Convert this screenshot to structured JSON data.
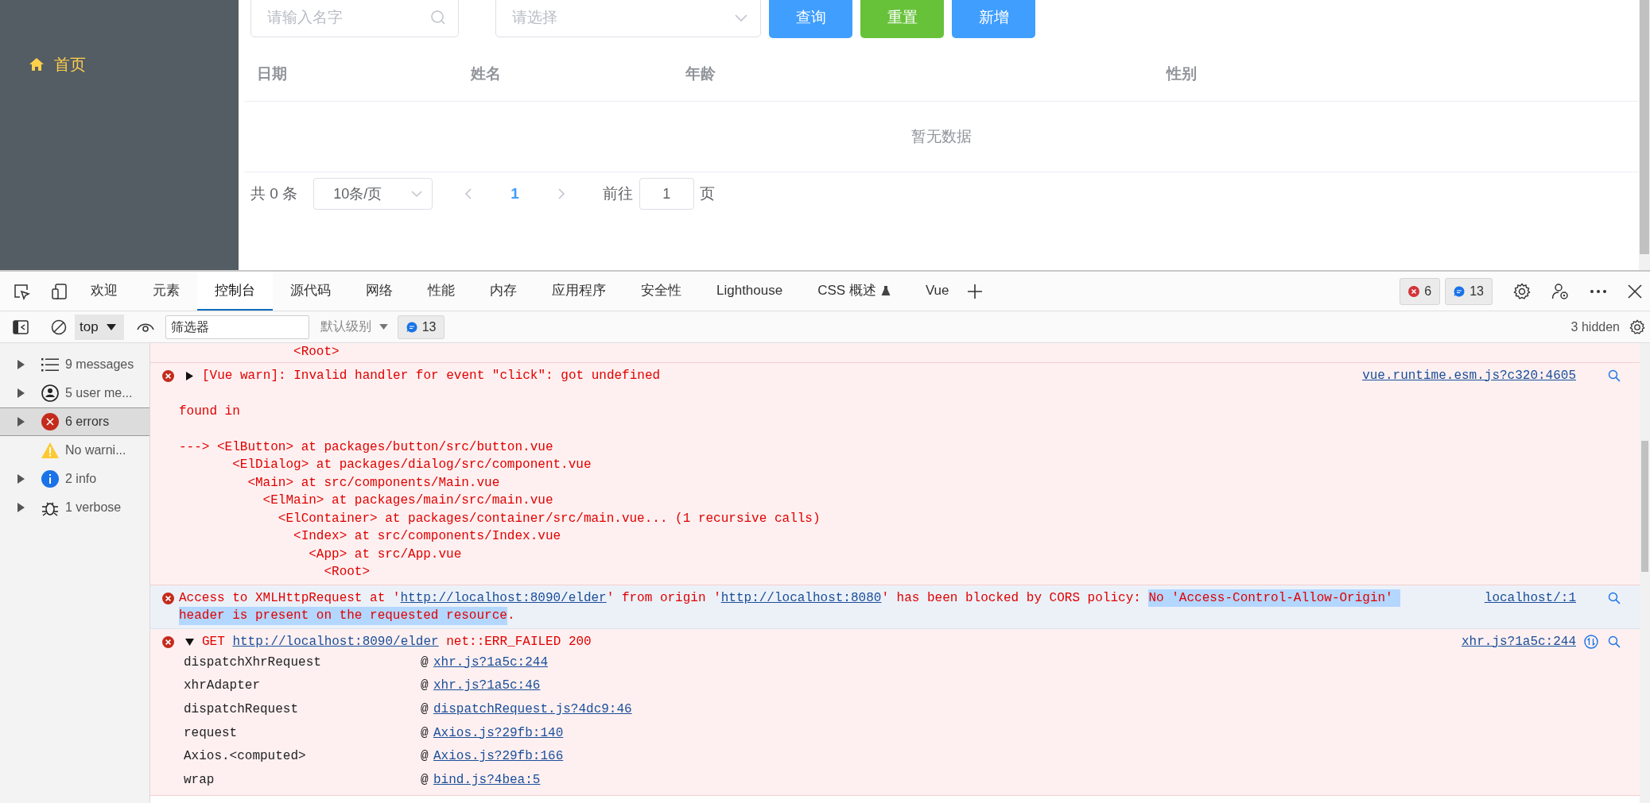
{
  "app": {
    "sidebar": {
      "items": [
        {
          "label": "首页"
        }
      ]
    },
    "toolbar": {
      "search": {
        "placeholder": "请输入名字"
      },
      "select": {
        "placeholder": "请选择"
      },
      "buttons": [
        {
          "label": "查询",
          "kind": "primary"
        },
        {
          "label": "重置",
          "kind": "success"
        },
        {
          "label": "新增",
          "kind": "primary"
        }
      ]
    },
    "table": {
      "columns": [
        "日期",
        "姓名",
        "年龄",
        "性别"
      ],
      "empty_text": "暂无数据"
    },
    "pagination": {
      "total": "共 0 条",
      "page_size": "10条/页",
      "pages": [
        {
          "label": "1",
          "selected": true
        }
      ],
      "jump_label": "前往",
      "jump_value": "1",
      "jump_unit": "页"
    }
  },
  "devtools": {
    "tabs": [
      {
        "label": "欢迎",
        "kind": "panel",
        "selected": false
      },
      {
        "label": "元素",
        "kind": "panel",
        "selected": false
      },
      {
        "label": "控制台",
        "kind": "panel",
        "selected": true
      },
      {
        "label": "源代码",
        "kind": "panel",
        "selected": false
      },
      {
        "label": "网络",
        "kind": "panel",
        "selected": false
      },
      {
        "label": "性能",
        "kind": "panel",
        "selected": false
      },
      {
        "label": "内存",
        "kind": "panel",
        "selected": false
      },
      {
        "label": "应用程序",
        "kind": "panel",
        "selected": false
      },
      {
        "label": "安全性",
        "kind": "panel",
        "selected": false
      },
      {
        "label": "Lighthouse",
        "kind": "panel",
        "selected": false
      },
      {
        "label": "CSS 概述",
        "kind": "experimental",
        "selected": false
      },
      {
        "label": "Vue",
        "kind": "panel",
        "selected": false
      }
    ],
    "error_count": "6",
    "issue_count": "13",
    "console_toolbar": {
      "context": "top",
      "filter": {
        "placeholder": "筛选器"
      },
      "level": "默认级别",
      "issues": "13",
      "hidden": "3 hidden"
    },
    "sidebar": [
      {
        "kind": "messages",
        "label": "9 messages",
        "selected": false,
        "expandable": true
      },
      {
        "kind": "user",
        "label": "5 user me...",
        "selected": false,
        "expandable": true
      },
      {
        "kind": "errors",
        "label": "6 errors",
        "selected": true,
        "expandable": true
      },
      {
        "kind": "warnings",
        "label": "No warni...",
        "selected": false,
        "expandable": false
      },
      {
        "kind": "info",
        "label": "2 info",
        "selected": false,
        "expandable": true
      },
      {
        "kind": "verbose",
        "label": "1 verbose",
        "selected": false,
        "expandable": true
      }
    ],
    "messages": [
      {
        "kind": "continuation",
        "hovered": false,
        "blocks": [
          [
            "               <Root>"
          ]
        ]
      },
      {
        "kind": "error",
        "hovered": false,
        "expanded": false,
        "segments": [
          {
            "text": "[Vue warn]: Invalid handler for event \"click\": got undefined",
            "kind": "text",
            "selected": false
          }
        ],
        "source": "vue.runtime.esm.js?c320:4605",
        "blocks": [
          [
            "found in"
          ],
          [
            "---> <ElButton> at packages/button/src/button.vue",
            "       <ElDialog> at packages/dialog/src/component.vue",
            "         <Main> at src/components/Main.vue",
            "           <ElMain> at packages/main/src/main.vue",
            "             <ElContainer> at packages/container/src/main.vue... (1 recursive calls)",
            "               <Index> at src/components/Index.vue",
            "                 <App> at src/App.vue",
            "                   <Root>"
          ]
        ]
      },
      {
        "kind": "error",
        "hovered": true,
        "segments": [
          {
            "text": "Access to XMLHttpRequest at '",
            "kind": "text",
            "selected": false
          },
          {
            "text": "http://localhost:8090/elder",
            "kind": "link",
            "selected": false
          },
          {
            "text": "' from origin '",
            "kind": "text",
            "selected": false
          },
          {
            "text": "http://localhost:8080",
            "kind": "link",
            "selected": false
          },
          {
            "text": "' has been blocked by CORS policy: ",
            "kind": "text",
            "selected": false
          },
          {
            "text": "No 'Access-Control-Allow-Origin' ",
            "kind": "text",
            "selected": true
          },
          {
            "text": "header is present on the requested resource",
            "kind": "text",
            "selected": true
          },
          {
            "text": ".",
            "kind": "text",
            "selected": false
          }
        ],
        "source": "localhost/:1"
      },
      {
        "kind": "error",
        "hovered": false,
        "expanded": true,
        "network": true,
        "segments": [
          {
            "text": "GET ",
            "kind": "text",
            "selected": false
          },
          {
            "text": "http://localhost:8090/elder",
            "kind": "link",
            "selected": false
          },
          {
            "text": " net::ERR_FAILED 200",
            "kind": "text",
            "selected": false
          }
        ],
        "source": "xhr.js?1a5c:244",
        "frames": [
          {
            "function": "dispatchXhrRequest",
            "at": "@",
            "location": "xhr.js?1a5c:244"
          },
          {
            "function": "xhrAdapter",
            "at": "@",
            "location": "xhr.js?1a5c:46"
          },
          {
            "function": "dispatchRequest",
            "at": "@",
            "location": "dispatchRequest.js?4dc9:46"
          },
          {
            "function": "request",
            "at": "@",
            "location": "Axios.js?29fb:140"
          },
          {
            "function": "Axios.<computed>",
            "at": "@",
            "location": "Axios.js?29fb:166"
          },
          {
            "function": "wrap",
            "at": "@",
            "location": "bind.js?4bea:5"
          }
        ]
      }
    ]
  }
}
